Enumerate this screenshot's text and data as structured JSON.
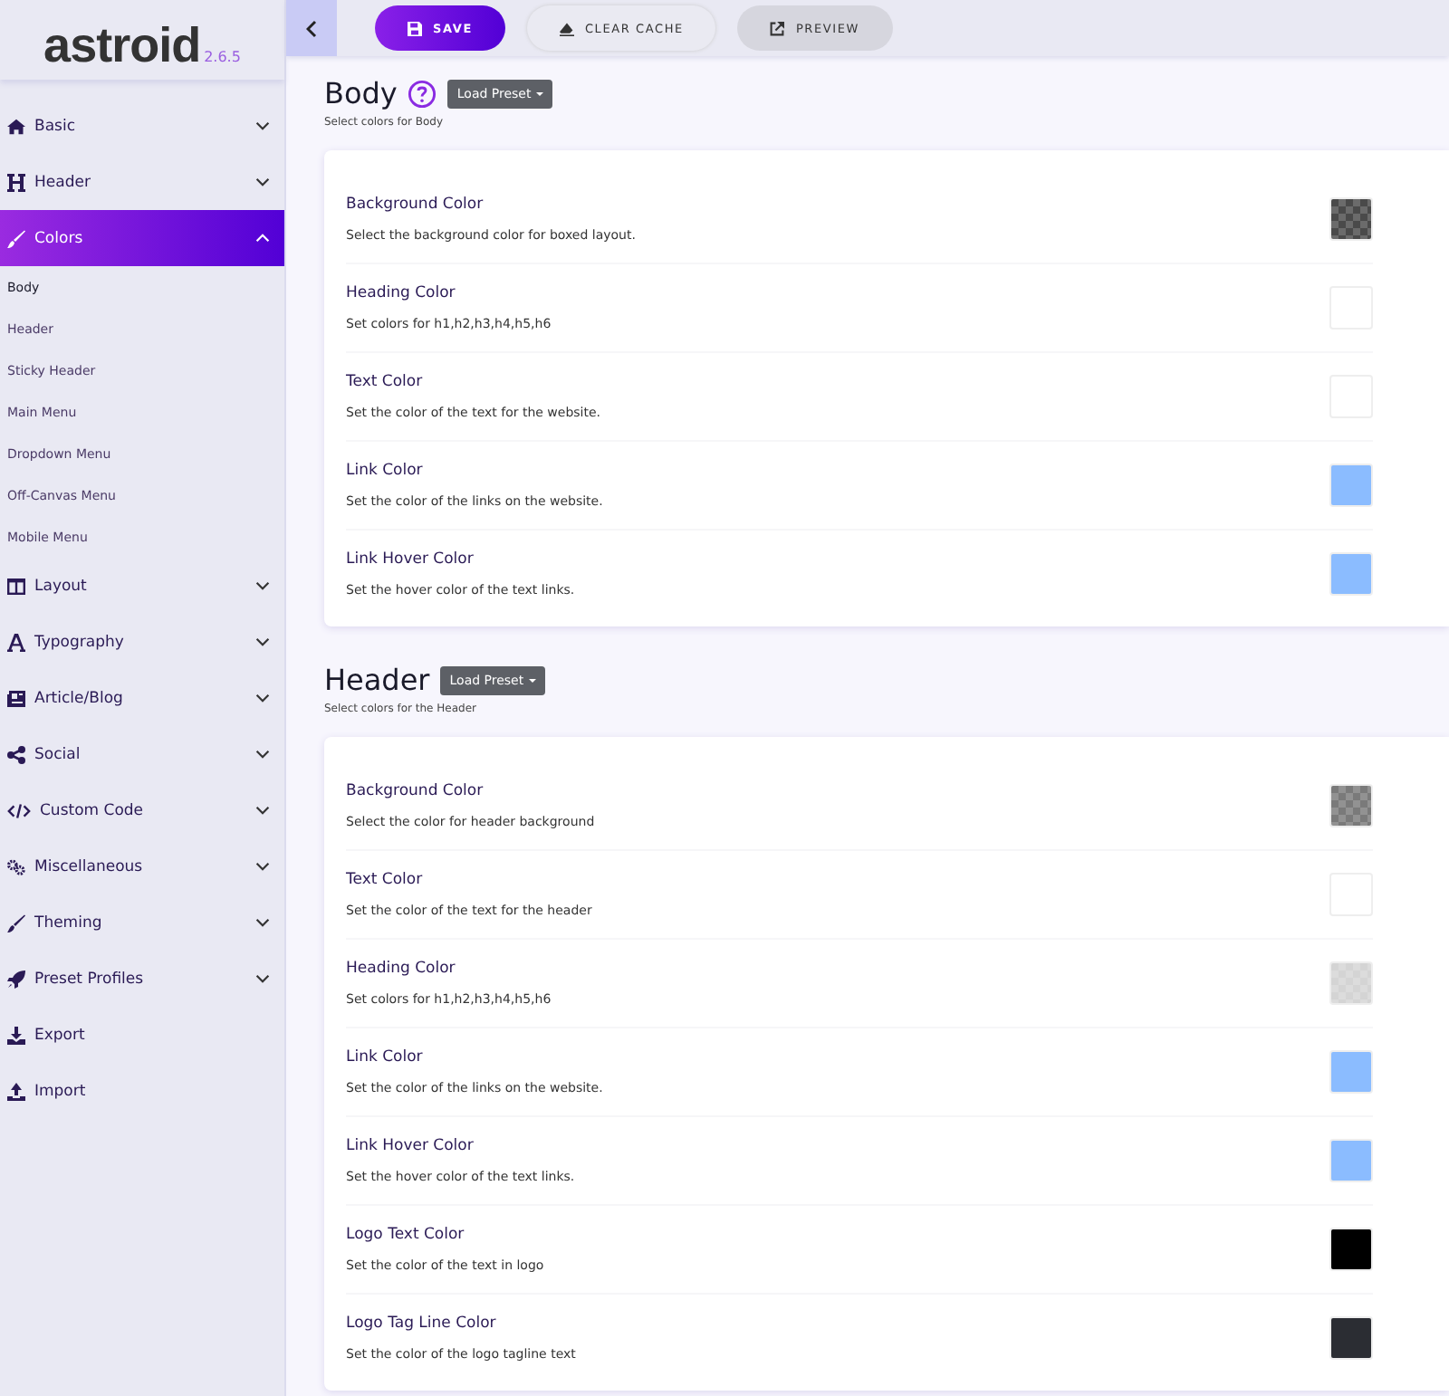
{
  "logo": {
    "name": "astroid",
    "version": "2.6.5"
  },
  "toolbar": {
    "buttons": [
      {
        "label": "SAVE",
        "kind": "save"
      },
      {
        "label": "CLEAR CACHE",
        "kind": "clear"
      },
      {
        "label": "PREVIEW",
        "kind": "preview"
      }
    ]
  },
  "sidebar": {
    "items": [
      {
        "label": "Basic",
        "expanded": false,
        "selected": false
      },
      {
        "label": "Header",
        "expanded": false,
        "selected": false
      },
      {
        "label": "Colors",
        "expanded": true,
        "selected": true,
        "children": [
          {
            "label": "Body",
            "selected": true
          },
          {
            "label": "Header",
            "selected": false
          },
          {
            "label": "Sticky Header",
            "selected": false
          },
          {
            "label": "Main Menu",
            "selected": false
          },
          {
            "label": "Dropdown Menu",
            "selected": false
          },
          {
            "label": "Off-Canvas Menu",
            "selected": false
          },
          {
            "label": "Mobile Menu",
            "selected": false
          }
        ]
      },
      {
        "label": "Layout",
        "expanded": false,
        "selected": false
      },
      {
        "label": "Typography",
        "expanded": false,
        "selected": false
      },
      {
        "label": "Article/Blog",
        "expanded": false,
        "selected": false
      },
      {
        "label": "Social",
        "expanded": false,
        "selected": false
      },
      {
        "label": "Custom Code",
        "expanded": false,
        "selected": false
      },
      {
        "label": "Miscellaneous",
        "expanded": false,
        "selected": false
      },
      {
        "label": "Theming",
        "expanded": false,
        "selected": false
      },
      {
        "label": "Preset Profiles",
        "expanded": false,
        "selected": false
      },
      {
        "label": "Export",
        "selected": false
      },
      {
        "label": "Import",
        "selected": false
      }
    ]
  },
  "sections": [
    {
      "title": "Body",
      "help": true,
      "preset_button": "Load Preset",
      "subtitle": "Select colors for Body",
      "fields": [
        {
          "label": "Background Color",
          "description": "Select the background color for boxed layout.",
          "kind": "checker",
          "color": "#4a4a4a"
        },
        {
          "label": "Heading Color",
          "description": "Set colors for h1,h2,h3,h4,h5,h6",
          "kind": "solid",
          "color": "#ffffff"
        },
        {
          "label": "Text Color",
          "description": "Set the color of the text for the website.",
          "kind": "solid",
          "color": "#ffffff"
        },
        {
          "label": "Link Color",
          "description": "Set the color of the links on the website.",
          "kind": "solid",
          "color": "#8bbcff"
        },
        {
          "label": "Link Hover Color",
          "description": "Set the hover color of the text links.",
          "kind": "solid",
          "color": "#8bbcff"
        }
      ]
    },
    {
      "title": "Header",
      "help": false,
      "preset_button": "Load Preset",
      "subtitle": "Select colors for the Header",
      "fields": [
        {
          "label": "Background Color",
          "description": "Select the color for header background",
          "kind": "checker",
          "color": "#7a7a7a"
        },
        {
          "label": "Text Color",
          "description": "Set the color of the text for the header",
          "kind": "solid",
          "color": "#ffffff"
        },
        {
          "label": "Heading Color",
          "description": "Set colors for h1,h2,h3,h4,h5,h6",
          "kind": "checker",
          "color": "#d4d4d4"
        },
        {
          "label": "Link Color",
          "description": "Set the color of the links on the website.",
          "kind": "solid",
          "color": "#8bbcff"
        },
        {
          "label": "Link Hover Color",
          "description": "Set the hover color of the text links.",
          "kind": "solid",
          "color": "#8bbcff"
        },
        {
          "label": "Logo Text Color",
          "description": "Set the color of the text in logo",
          "kind": "solid",
          "color": "#000000"
        },
        {
          "label": "Logo Tag Line Color",
          "description": "Set the color of the logo tagline text",
          "kind": "solid",
          "color": "#2b2d33"
        }
      ]
    }
  ]
}
